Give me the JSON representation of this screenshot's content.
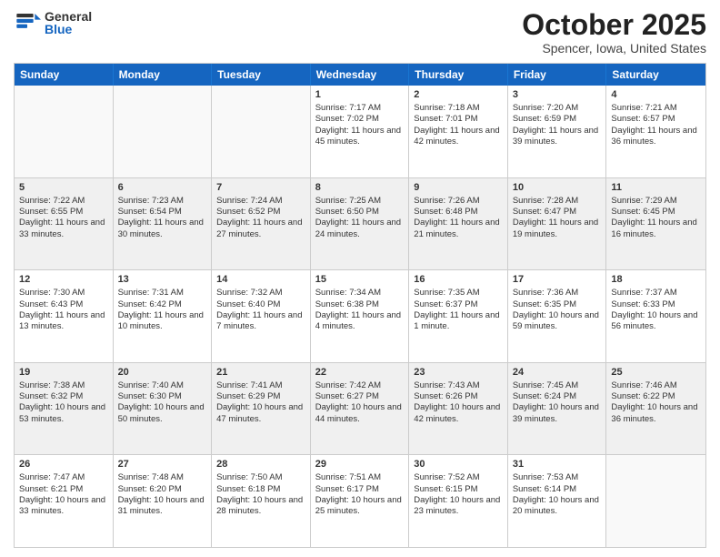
{
  "header": {
    "logo_general": "General",
    "logo_blue": "Blue",
    "month_title": "October 2025",
    "location": "Spencer, Iowa, United States"
  },
  "weekdays": [
    "Sunday",
    "Monday",
    "Tuesday",
    "Wednesday",
    "Thursday",
    "Friday",
    "Saturday"
  ],
  "rows": [
    [
      {
        "day": "",
        "text": "",
        "empty": true
      },
      {
        "day": "",
        "text": "",
        "empty": true
      },
      {
        "day": "",
        "text": "",
        "empty": true
      },
      {
        "day": "1",
        "text": "Sunrise: 7:17 AM\nSunset: 7:02 PM\nDaylight: 11 hours and 45 minutes."
      },
      {
        "day": "2",
        "text": "Sunrise: 7:18 AM\nSunset: 7:01 PM\nDaylight: 11 hours and 42 minutes."
      },
      {
        "day": "3",
        "text": "Sunrise: 7:20 AM\nSunset: 6:59 PM\nDaylight: 11 hours and 39 minutes."
      },
      {
        "day": "4",
        "text": "Sunrise: 7:21 AM\nSunset: 6:57 PM\nDaylight: 11 hours and 36 minutes."
      }
    ],
    [
      {
        "day": "5",
        "text": "Sunrise: 7:22 AM\nSunset: 6:55 PM\nDaylight: 11 hours and 33 minutes."
      },
      {
        "day": "6",
        "text": "Sunrise: 7:23 AM\nSunset: 6:54 PM\nDaylight: 11 hours and 30 minutes."
      },
      {
        "day": "7",
        "text": "Sunrise: 7:24 AM\nSunset: 6:52 PM\nDaylight: 11 hours and 27 minutes."
      },
      {
        "day": "8",
        "text": "Sunrise: 7:25 AM\nSunset: 6:50 PM\nDaylight: 11 hours and 24 minutes."
      },
      {
        "day": "9",
        "text": "Sunrise: 7:26 AM\nSunset: 6:48 PM\nDaylight: 11 hours and 21 minutes."
      },
      {
        "day": "10",
        "text": "Sunrise: 7:28 AM\nSunset: 6:47 PM\nDaylight: 11 hours and 19 minutes."
      },
      {
        "day": "11",
        "text": "Sunrise: 7:29 AM\nSunset: 6:45 PM\nDaylight: 11 hours and 16 minutes."
      }
    ],
    [
      {
        "day": "12",
        "text": "Sunrise: 7:30 AM\nSunset: 6:43 PM\nDaylight: 11 hours and 13 minutes."
      },
      {
        "day": "13",
        "text": "Sunrise: 7:31 AM\nSunset: 6:42 PM\nDaylight: 11 hours and 10 minutes."
      },
      {
        "day": "14",
        "text": "Sunrise: 7:32 AM\nSunset: 6:40 PM\nDaylight: 11 hours and 7 minutes."
      },
      {
        "day": "15",
        "text": "Sunrise: 7:34 AM\nSunset: 6:38 PM\nDaylight: 11 hours and 4 minutes."
      },
      {
        "day": "16",
        "text": "Sunrise: 7:35 AM\nSunset: 6:37 PM\nDaylight: 11 hours and 1 minute."
      },
      {
        "day": "17",
        "text": "Sunrise: 7:36 AM\nSunset: 6:35 PM\nDaylight: 10 hours and 59 minutes."
      },
      {
        "day": "18",
        "text": "Sunrise: 7:37 AM\nSunset: 6:33 PM\nDaylight: 10 hours and 56 minutes."
      }
    ],
    [
      {
        "day": "19",
        "text": "Sunrise: 7:38 AM\nSunset: 6:32 PM\nDaylight: 10 hours and 53 minutes."
      },
      {
        "day": "20",
        "text": "Sunrise: 7:40 AM\nSunset: 6:30 PM\nDaylight: 10 hours and 50 minutes."
      },
      {
        "day": "21",
        "text": "Sunrise: 7:41 AM\nSunset: 6:29 PM\nDaylight: 10 hours and 47 minutes."
      },
      {
        "day": "22",
        "text": "Sunrise: 7:42 AM\nSunset: 6:27 PM\nDaylight: 10 hours and 44 minutes."
      },
      {
        "day": "23",
        "text": "Sunrise: 7:43 AM\nSunset: 6:26 PM\nDaylight: 10 hours and 42 minutes."
      },
      {
        "day": "24",
        "text": "Sunrise: 7:45 AM\nSunset: 6:24 PM\nDaylight: 10 hours and 39 minutes."
      },
      {
        "day": "25",
        "text": "Sunrise: 7:46 AM\nSunset: 6:22 PM\nDaylight: 10 hours and 36 minutes."
      }
    ],
    [
      {
        "day": "26",
        "text": "Sunrise: 7:47 AM\nSunset: 6:21 PM\nDaylight: 10 hours and 33 minutes."
      },
      {
        "day": "27",
        "text": "Sunrise: 7:48 AM\nSunset: 6:20 PM\nDaylight: 10 hours and 31 minutes."
      },
      {
        "day": "28",
        "text": "Sunrise: 7:50 AM\nSunset: 6:18 PM\nDaylight: 10 hours and 28 minutes."
      },
      {
        "day": "29",
        "text": "Sunrise: 7:51 AM\nSunset: 6:17 PM\nDaylight: 10 hours and 25 minutes."
      },
      {
        "day": "30",
        "text": "Sunrise: 7:52 AM\nSunset: 6:15 PM\nDaylight: 10 hours and 23 minutes."
      },
      {
        "day": "31",
        "text": "Sunrise: 7:53 AM\nSunset: 6:14 PM\nDaylight: 10 hours and 20 minutes."
      },
      {
        "day": "",
        "text": "",
        "empty": true
      }
    ]
  ]
}
